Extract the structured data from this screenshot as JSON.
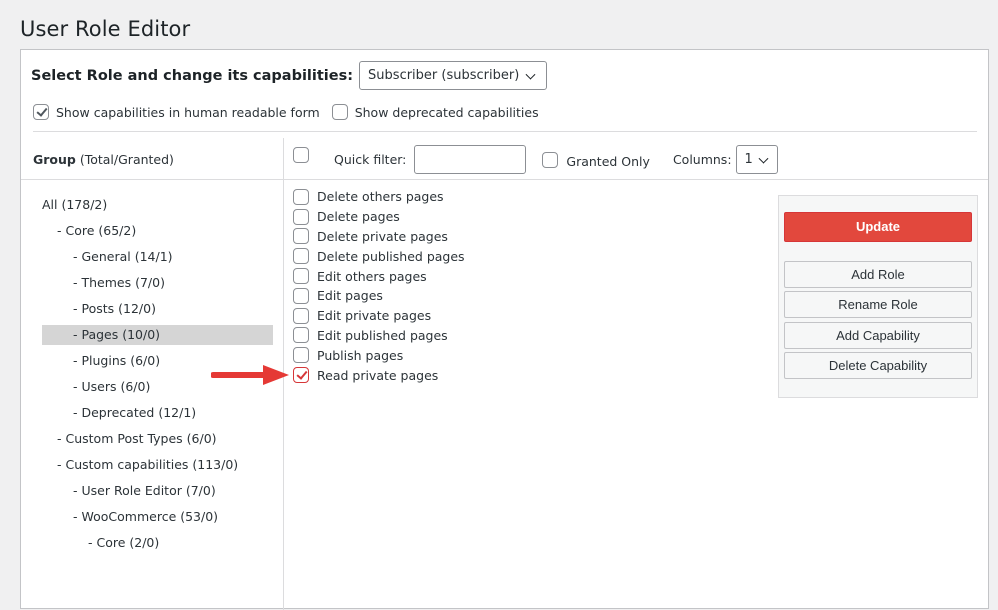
{
  "title": "User Role Editor",
  "role_select": {
    "label": "Select Role and change its capabilities:",
    "value": "Subscriber (subscriber)"
  },
  "options": {
    "human_readable": {
      "label": "Show capabilities in human readable form",
      "checked": true
    },
    "deprecated": {
      "label": "Show deprecated capabilities",
      "checked": false
    }
  },
  "group_header": {
    "bold": "Group",
    "rest": " (Total/Granted)"
  },
  "filter": {
    "quick_filter_label": "Quick filter:",
    "quick_filter_value": "",
    "granted_only_label": "Granted Only",
    "columns_label": "Columns:",
    "columns_value": "1"
  },
  "groups": [
    {
      "label": "All (178/2)",
      "level": 0
    },
    {
      "label": "- Core (65/2)",
      "level": 1
    },
    {
      "label": "- General (14/1)",
      "level": 2
    },
    {
      "label": "- Themes (7/0)",
      "level": 2
    },
    {
      "label": "- Posts (12/0)",
      "level": 2
    },
    {
      "label": "- Pages (10/0)",
      "level": 2,
      "active": true
    },
    {
      "label": "- Plugins (6/0)",
      "level": 2
    },
    {
      "label": "- Users (6/0)",
      "level": 2
    },
    {
      "label": "- Deprecated (12/1)",
      "level": 2
    },
    {
      "label": "- Custom Post Types (6/0)",
      "level": 1
    },
    {
      "label": "- Custom capabilities (113/0)",
      "level": 1
    },
    {
      "label": "- User Role Editor (7/0)",
      "level": 2
    },
    {
      "label": "- WooCommerce (53/0)",
      "level": 2
    },
    {
      "label": "- Core (2/0)",
      "level": 3
    }
  ],
  "capabilities": [
    {
      "label": "Delete others pages",
      "checked": false
    },
    {
      "label": "Delete pages",
      "checked": false
    },
    {
      "label": "Delete private pages",
      "checked": false
    },
    {
      "label": "Delete published pages",
      "checked": false
    },
    {
      "label": "Edit others pages",
      "checked": false
    },
    {
      "label": "Edit pages",
      "checked": false
    },
    {
      "label": "Edit private pages",
      "checked": false
    },
    {
      "label": "Edit published pages",
      "checked": false
    },
    {
      "label": "Publish pages",
      "checked": false
    },
    {
      "label": "Read private pages",
      "checked": true,
      "highlighted": true
    }
  ],
  "buttons": {
    "update": "Update",
    "add_role": "Add Role",
    "rename_role": "Rename Role",
    "add_capability": "Add Capability",
    "delete_capability": "Delete Capability"
  },
  "colors": {
    "update_button": "#e2483d",
    "arrow": "#e53935",
    "active_group": "#d5d5d5"
  }
}
